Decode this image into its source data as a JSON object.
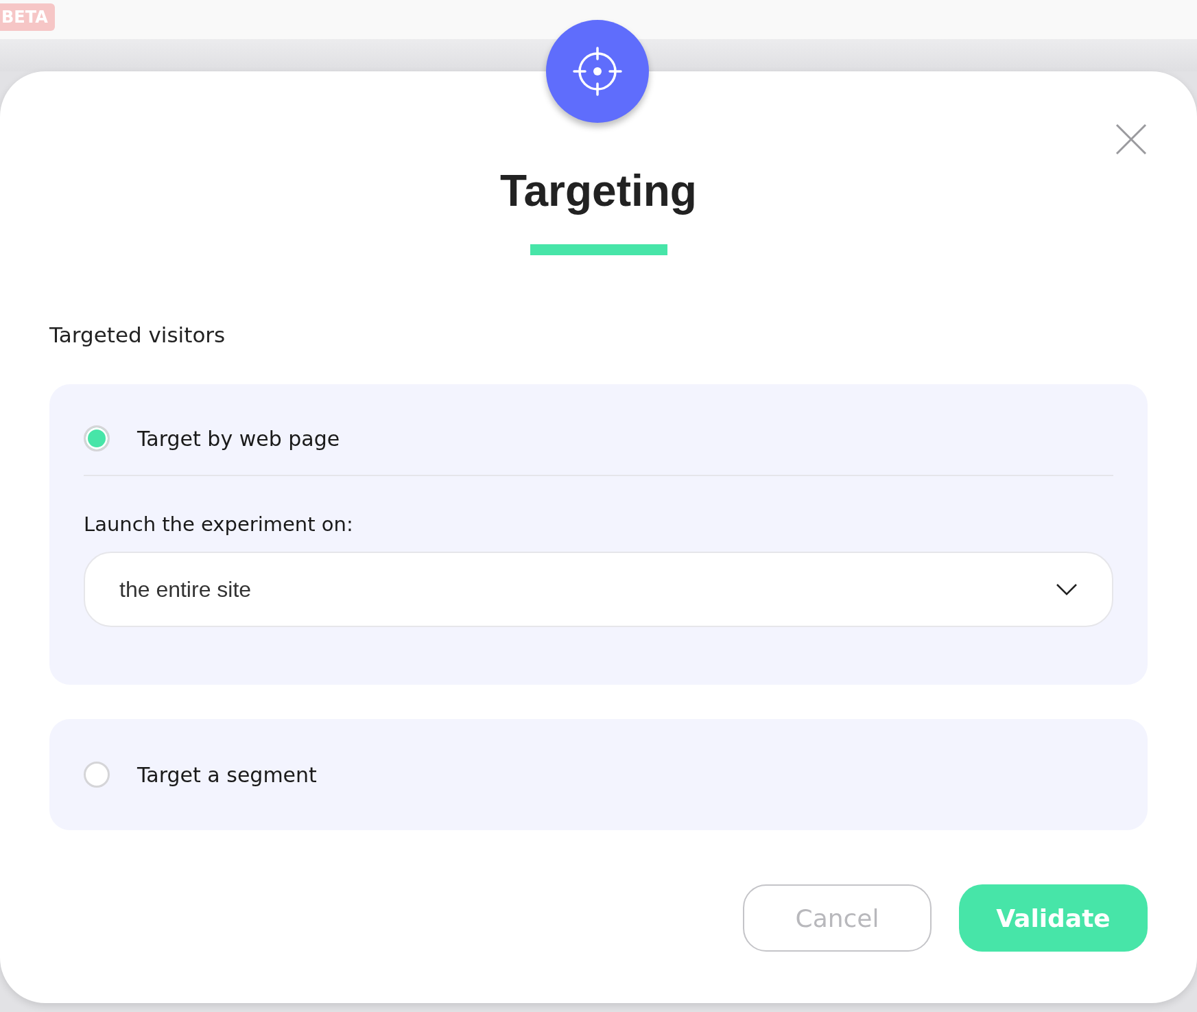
{
  "badge": "BETA",
  "dialog": {
    "title": "Targeting",
    "section_title": "Targeted visitors",
    "options": [
      {
        "label": "Target by web page",
        "selected": true,
        "launch_label": "Launch the experiment on:",
        "select_value": "the entire site"
      },
      {
        "label": "Target a segment",
        "selected": false
      }
    ],
    "buttons": [
      {
        "label": "Cancel",
        "kind": "secondary"
      },
      {
        "label": "Validate",
        "kind": "primary"
      }
    ]
  }
}
